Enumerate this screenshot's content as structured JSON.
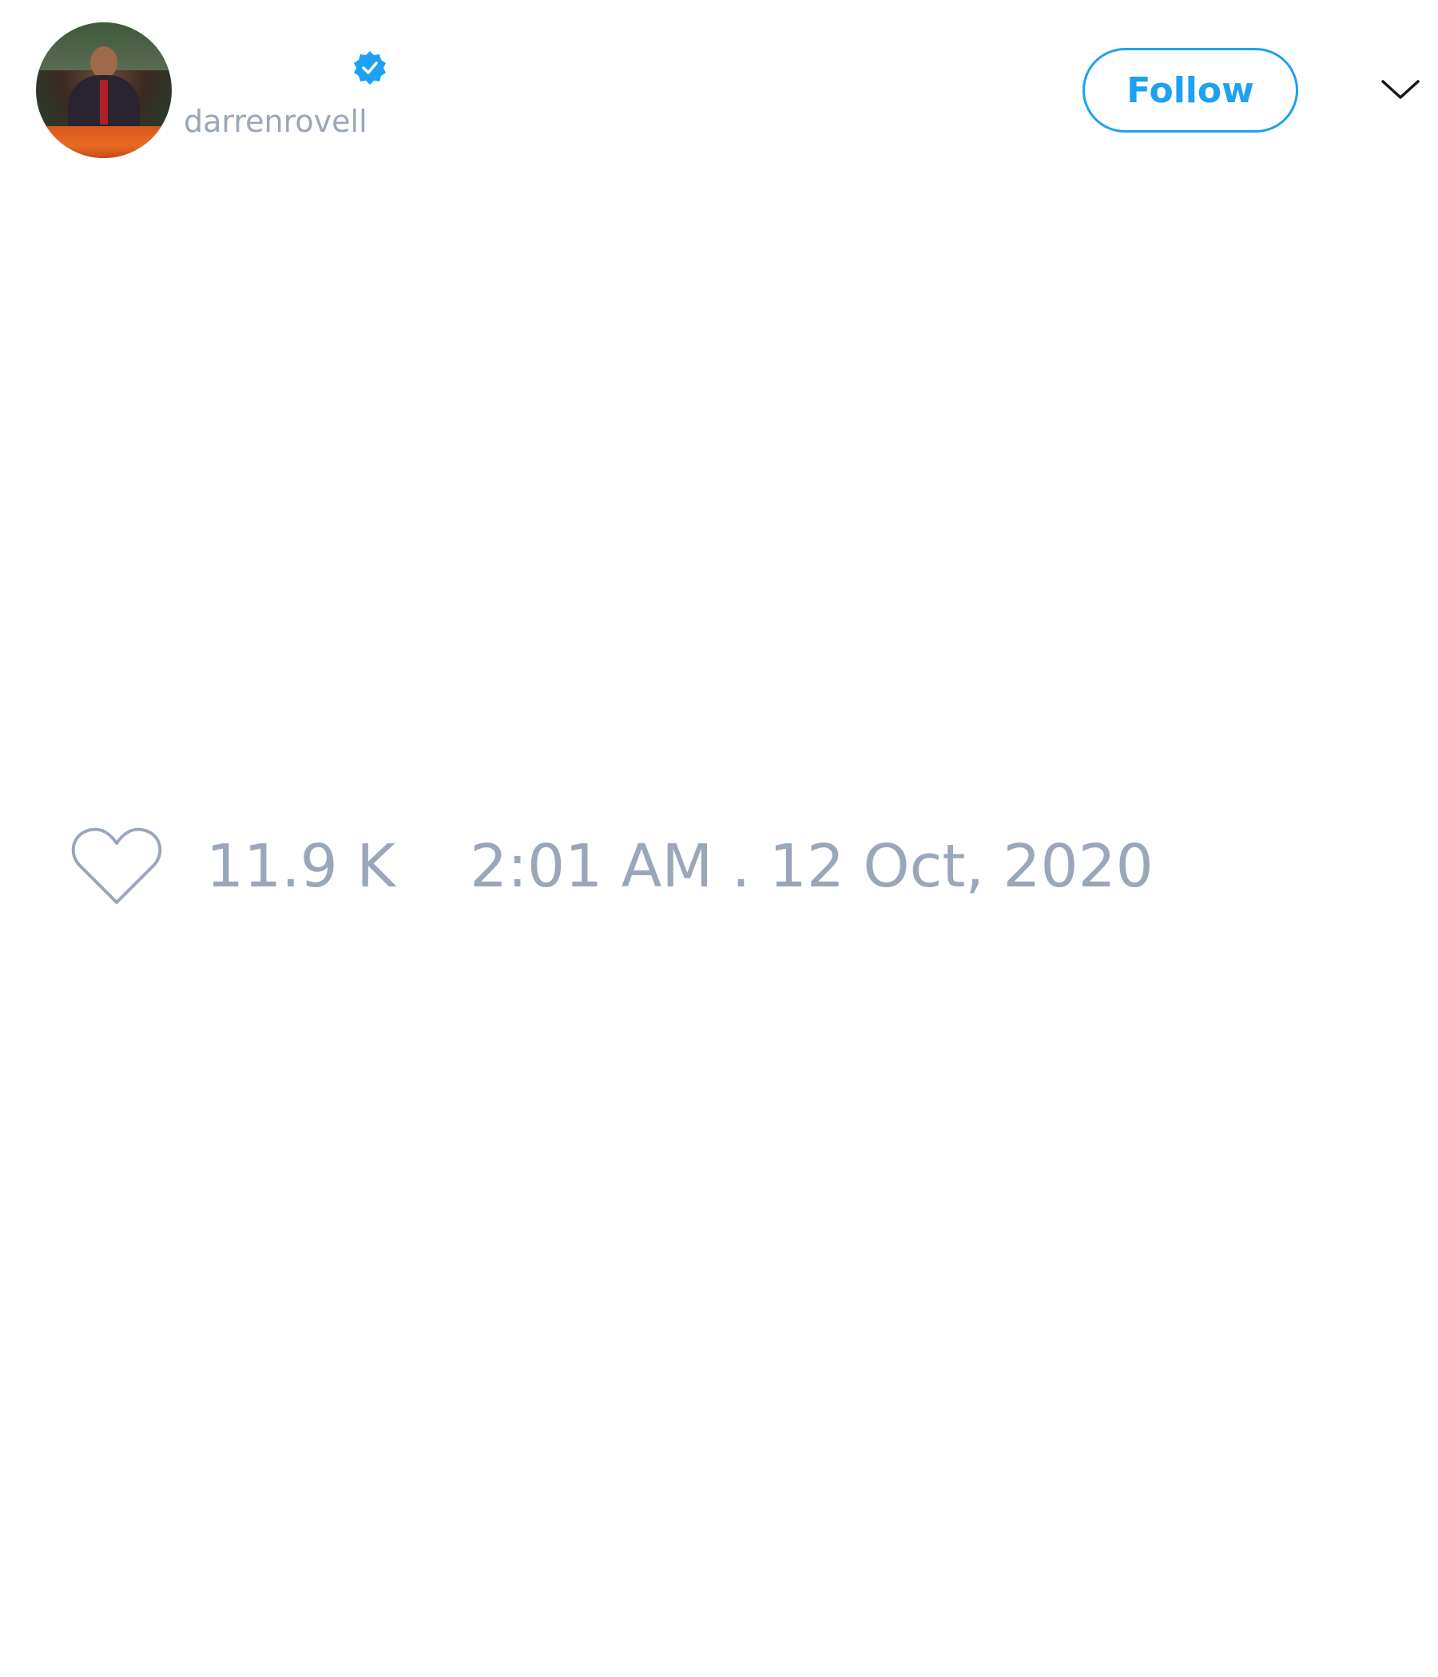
{
  "author": {
    "display_name": "",
    "handle": "darrenrovell",
    "verified": true,
    "avatar_icon": "profile-photo"
  },
  "actions": {
    "follow_label": "Follow",
    "menu_icon": "chevron-down-icon"
  },
  "stats": {
    "like_icon": "heart-icon",
    "like_count": "11.9 K",
    "timestamp": "2:01 AM . 12 Oct, 2020"
  },
  "colors": {
    "accent": "#1da1f2",
    "muted_text": "#9aa7ba",
    "background": "#ffffff"
  }
}
